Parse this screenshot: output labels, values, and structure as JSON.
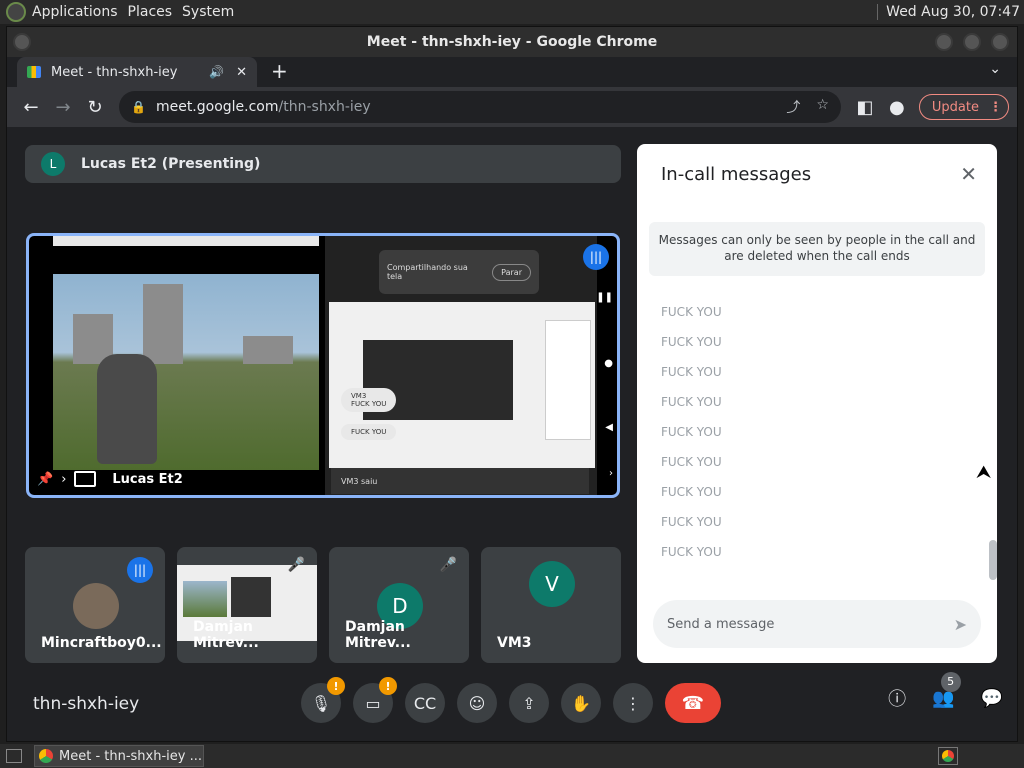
{
  "gnome": {
    "applications": "Applications",
    "places": "Places",
    "system": "System",
    "clock": "Wed Aug 30, 07:47"
  },
  "window": {
    "title": "Meet - thn-shxh-iey - Google Chrome"
  },
  "tab": {
    "title": "Meet - thn-shxh-iey"
  },
  "address": {
    "host": "meet.google.com",
    "path": "/thn-shxh-iey"
  },
  "update_label": "Update",
  "presenting": {
    "initial": "L",
    "label": "Lucas Et2 (Presenting)"
  },
  "main_tile": {
    "name": "Lucas Et2",
    "share_popup": "Compartilhando sua tela",
    "stop_label": "Parar",
    "chip1_name": "VM3",
    "chip1_text": "FUCK YOU",
    "chip2_text": "FUCK YOU",
    "toast": "VM3 saiu"
  },
  "participants": [
    {
      "name": "Mincraftboy0..."
    },
    {
      "name": "Damjan Mitrev..."
    },
    {
      "name": "Damjan Mitrev...",
      "initial": "D",
      "color": "#0d7a6a"
    },
    {
      "name": "VM3",
      "initial": "V",
      "color": "#0d7a6a"
    }
  ],
  "meeting_code": "thn-shxh-iey",
  "people_count": "5",
  "chat": {
    "title": "In-call messages",
    "notice": "Messages can only be seen by people in the call and are deleted when the call ends",
    "messages": [
      "FUCK YOU",
      "FUCK YOU",
      "FUCK YOU",
      "FUCK YOU",
      "FUCK YOU",
      "FUCK YOU",
      "FUCK YOU",
      "FUCK YOU",
      "FUCK YOU"
    ],
    "placeholder": "Send a message"
  },
  "taskbar": {
    "task": "Meet - thn-shxh-iey ..."
  },
  "colors": {
    "accent": "#8ab4f8",
    "end_call": "#ea4335",
    "warning": "#f29900",
    "speaking": "#1a73e8"
  }
}
